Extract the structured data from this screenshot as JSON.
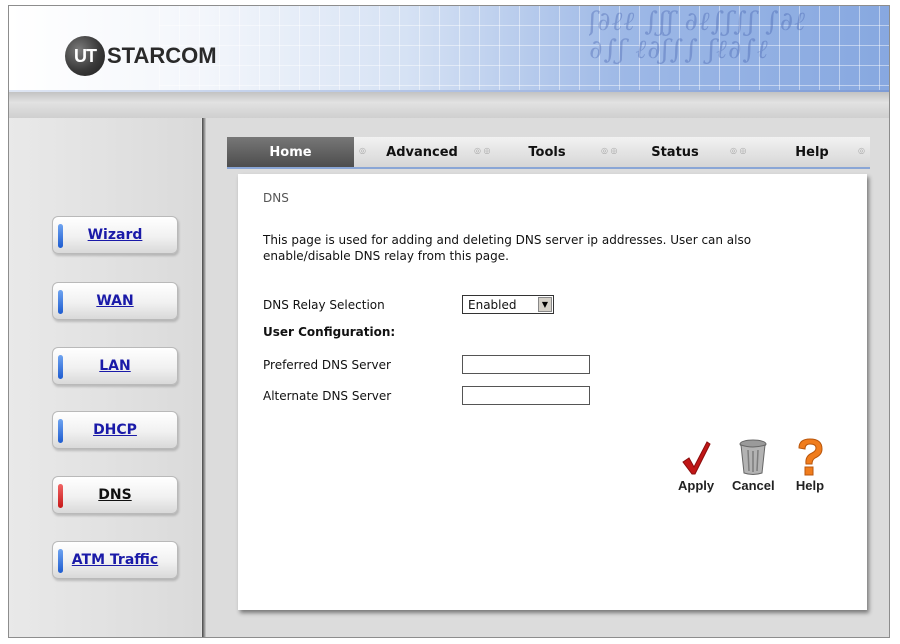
{
  "brand": {
    "logo_mark": "UT",
    "logo_text": "STARCOM"
  },
  "tabs": [
    {
      "label": "Home",
      "active": true
    },
    {
      "label": "Advanced",
      "active": false
    },
    {
      "label": "Tools",
      "active": false
    },
    {
      "label": "Status",
      "active": false
    },
    {
      "label": "Help",
      "active": false
    }
  ],
  "sidebar": {
    "items": [
      {
        "label": "Wizard",
        "indicator": "blue"
      },
      {
        "label": "WAN",
        "indicator": "blue"
      },
      {
        "label": "LAN",
        "indicator": "blue"
      },
      {
        "label": "DHCP",
        "indicator": "blue"
      },
      {
        "label": "DNS",
        "indicator": "red",
        "selected": true
      },
      {
        "label": "ATM Traffic",
        "indicator": "blue"
      }
    ]
  },
  "page": {
    "title": "DNS",
    "description": "This page is used for adding and deleting DNS server ip addresses. User can also enable/disable DNS relay from this page.",
    "relay_label": "DNS Relay Selection",
    "relay_value": "Enabled",
    "user_config_label": "User Configuration:",
    "preferred_label": "Preferred DNS Server",
    "preferred_value": "",
    "alternate_label": "Alternate DNS Server",
    "alternate_value": ""
  },
  "actions": {
    "apply": "Apply",
    "cancel": "Cancel",
    "help": "Help"
  },
  "icons": {
    "apply": "checkmark-icon",
    "cancel": "trash-can-icon",
    "help": "question-mark-icon"
  },
  "colors": {
    "link_blue": "#1a1aa8",
    "active_indicator": "#c71818",
    "inactive_indicator": "#1d5bd0",
    "apply_red": "#c01616",
    "help_orange": "#f07c1c"
  }
}
